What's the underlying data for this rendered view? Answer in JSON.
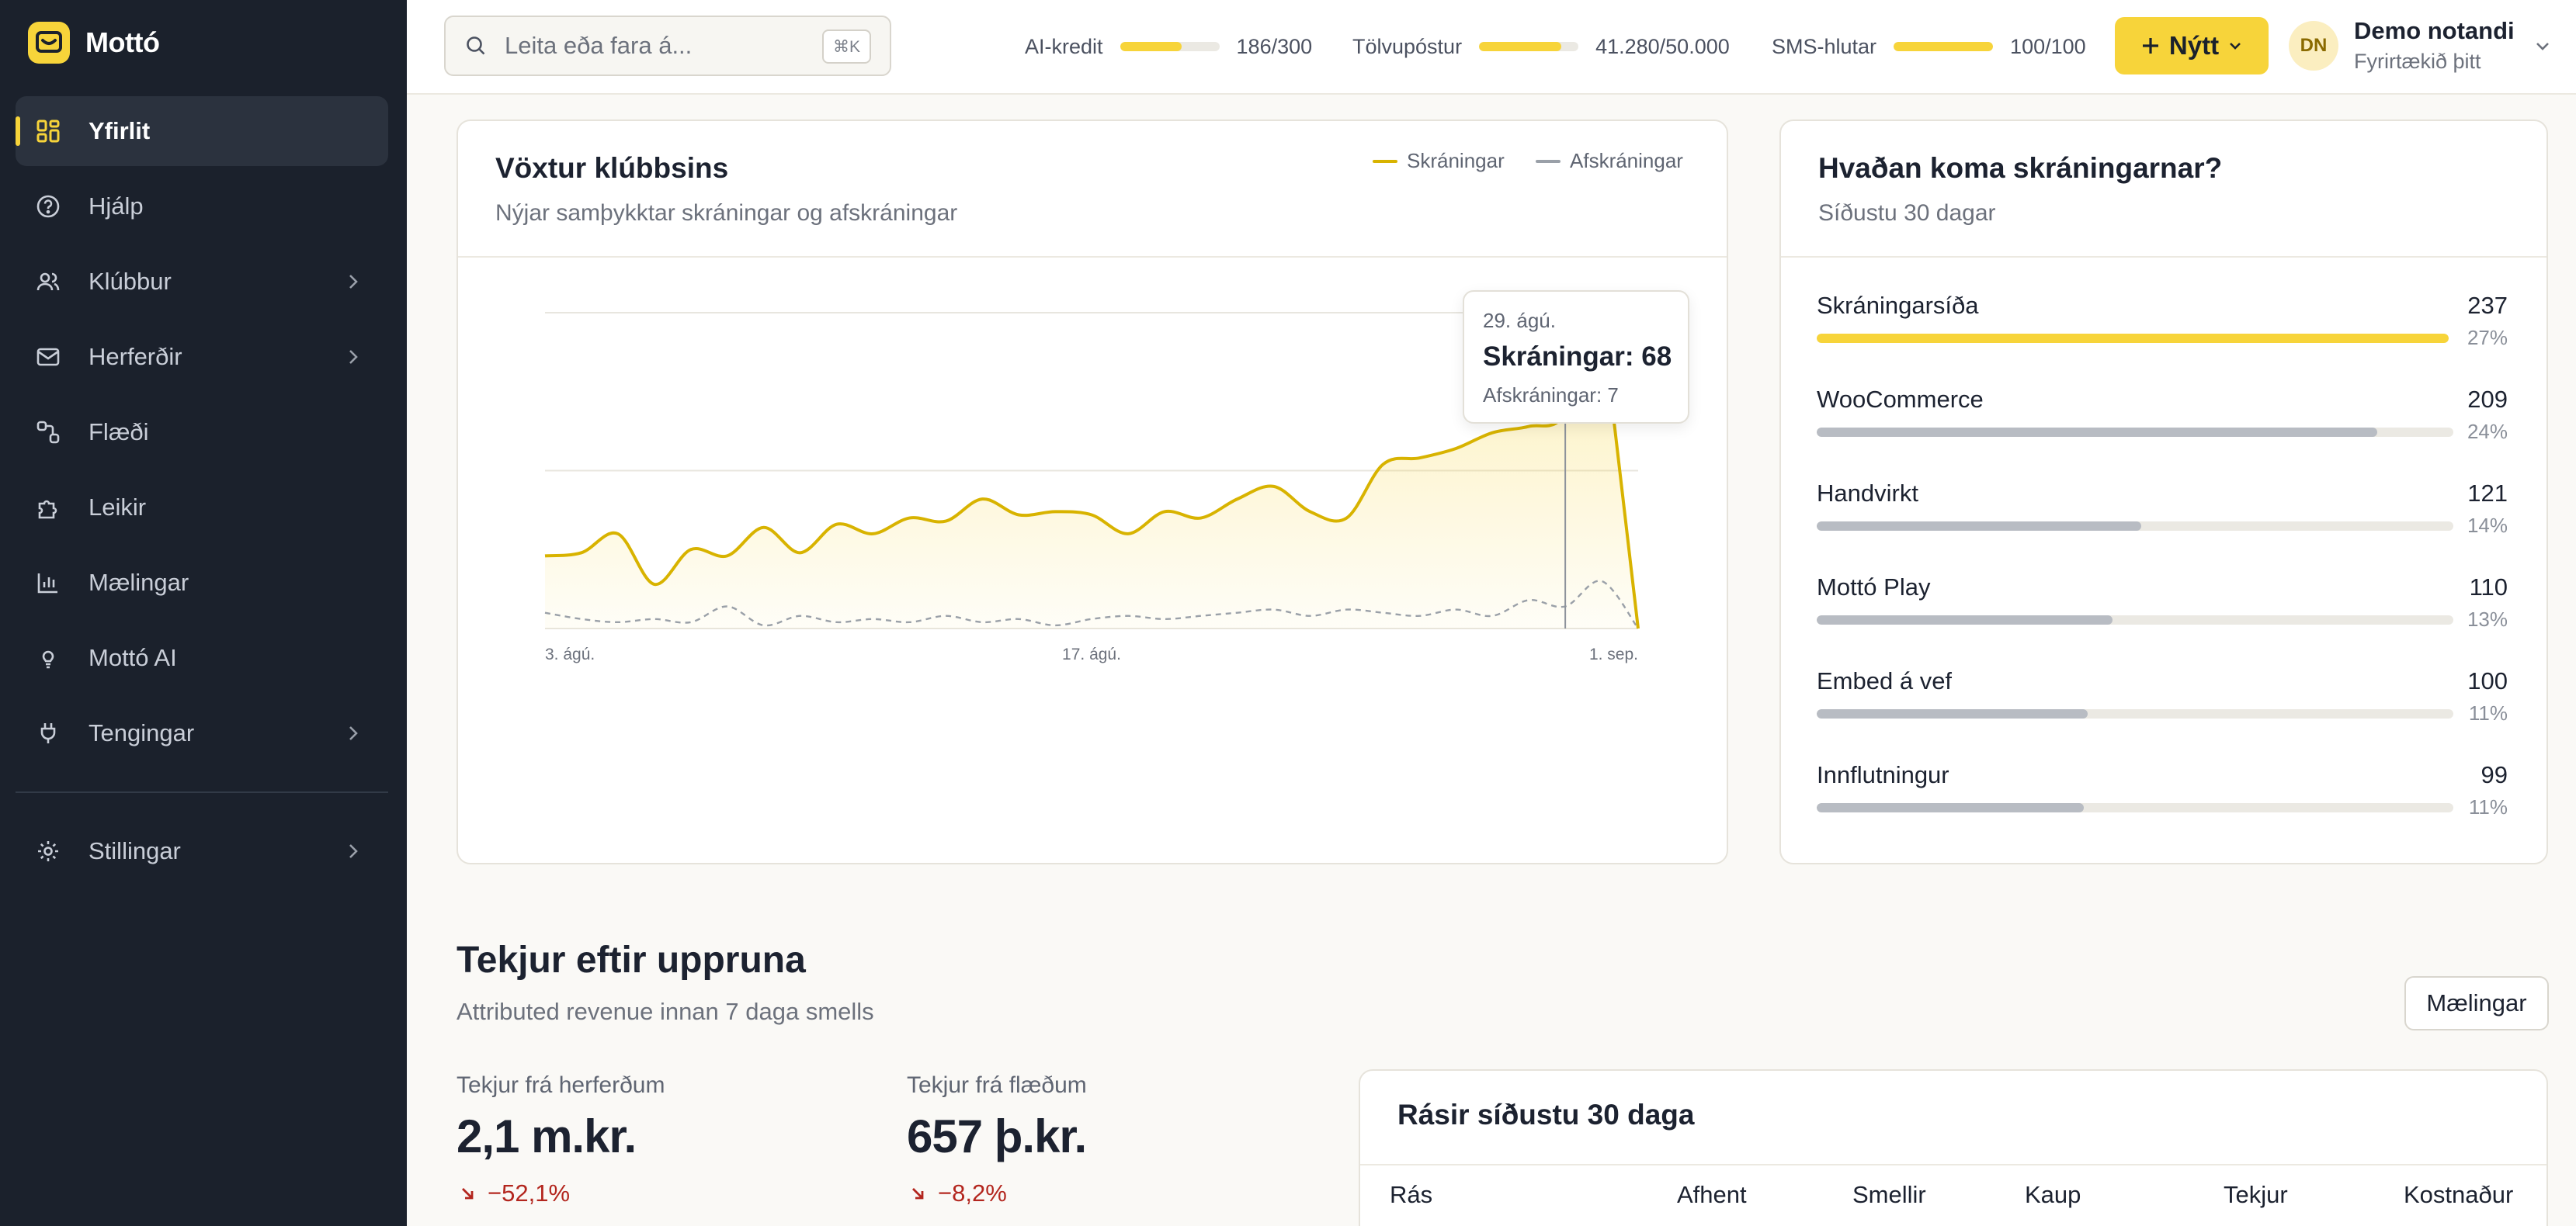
{
  "brand": {
    "name": "Mottó"
  },
  "sidebar": {
    "items": [
      {
        "label": "Yfirlit",
        "icon": "dashboard-icon",
        "active": true
      },
      {
        "label": "Hjálp",
        "icon": "help-circle-icon"
      },
      {
        "label": "Klúbbur",
        "icon": "users-icon",
        "has_submenu": true
      },
      {
        "label": "Herferðir",
        "icon": "mail-icon",
        "has_submenu": true
      },
      {
        "label": "Flæði",
        "icon": "flow-icon"
      },
      {
        "label": "Leikir",
        "icon": "puzzle-icon"
      },
      {
        "label": "Mælingar",
        "icon": "bar-chart-icon"
      },
      {
        "label": "Mottó AI",
        "icon": "lightbulb-icon"
      },
      {
        "label": "Tengingar",
        "icon": "plug-icon",
        "has_submenu": true
      }
    ],
    "footer_item": {
      "label": "Stillingar",
      "icon": "gear-icon",
      "has_submenu": true
    }
  },
  "topbar": {
    "search_placeholder": "Leita eða fara á...",
    "search_shortcut": "⌘K",
    "meters": [
      {
        "label": "AI-kredit",
        "value": "186/300",
        "fraction": 0.62
      },
      {
        "label": "Tölvupóstur",
        "value": "41.280/50.000",
        "fraction": 0.826
      },
      {
        "label": "SMS-hlutar",
        "value": "100/100",
        "fraction": 1.0
      }
    ],
    "new_button": "Nýtt",
    "user": {
      "initials": "DN",
      "name": "Demo notandi",
      "org": "Fyrirtækið þitt"
    }
  },
  "growth_card": {
    "title": "Vöxtur klúbbsins",
    "subtitle": "Nýjar samþykktar skráningar og afskráningar",
    "legend": [
      {
        "label": "Skráningar",
        "color": "#d8b300"
      },
      {
        "label": "Afskráningar",
        "color": "#9aa0a8"
      }
    ],
    "tooltip": {
      "date": "29. ágú.",
      "main": "Skráningar: 68",
      "sub": "Afskráningar: 7"
    }
  },
  "chart_data": {
    "type": "area",
    "x_tick_labels": [
      "3. ágú.",
      "17. ágú.",
      "1. sep."
    ],
    "ylim": [
      0,
      100
    ],
    "grid": true,
    "series": [
      {
        "name": "Skráningar",
        "color": "#d8b300",
        "values": [
          23,
          24,
          30,
          14,
          25,
          23,
          32,
          24,
          33,
          30,
          35,
          34,
          41,
          36,
          37,
          36,
          30,
          37,
          35,
          41,
          45,
          37,
          35,
          52,
          54,
          57,
          62,
          64,
          68,
          99,
          0
        ]
      },
      {
        "name": "Afskráningar",
        "color": "#9aa0a8",
        "values": [
          5,
          3,
          2,
          3,
          2,
          7,
          1,
          4,
          2,
          3,
          2,
          4,
          2,
          3,
          1,
          3,
          4,
          3,
          4,
          5,
          6,
          4,
          6,
          5,
          4,
          6,
          4,
          9,
          7,
          15,
          0
        ]
      }
    ]
  },
  "sources_card": {
    "title": "Hvaðan koma skráningarnar?",
    "subtitle": "Síðustu 30 dagar",
    "rows": [
      {
        "label": "Skráningarsíða",
        "count": "237",
        "pct": "27%",
        "fraction": 1.0,
        "color": "#f7d43a"
      },
      {
        "label": "WooCommerce",
        "count": "209",
        "pct": "24%",
        "fraction": 0.88,
        "color": "#b8bcc3"
      },
      {
        "label": "Handvirkt",
        "count": "121",
        "pct": "14%",
        "fraction": 0.51,
        "color": "#b8bcc3"
      },
      {
        "label": "Mottó Play",
        "count": "110",
        "pct": "13%",
        "fraction": 0.465,
        "color": "#b8bcc3"
      },
      {
        "label": "Embed á vef",
        "count": "100",
        "pct": "11%",
        "fraction": 0.425,
        "color": "#b8bcc3"
      },
      {
        "label": "Innflutningur",
        "count": "99",
        "pct": "11%",
        "fraction": 0.42,
        "color": "#b8bcc3"
      }
    ]
  },
  "revenue_section": {
    "title": "Tekjur eftir uppruna",
    "subtitle": "Attributed revenue innan 7 daga smells",
    "button": "Mælingar",
    "kpis": [
      {
        "label": "Tekjur frá herferðum",
        "value": "2,1 m.kr.",
        "change": "−52,1%"
      },
      {
        "label": "Tekjur frá flæðum",
        "value": "657 þ.kr.",
        "change": "−8,2%"
      }
    ],
    "channels_card": {
      "title": "Rásir síðustu 30 daga",
      "columns": [
        "Rás",
        "Afhent",
        "Smellir",
        "Kaup",
        "Tekjur",
        "Kostnaður"
      ]
    }
  }
}
